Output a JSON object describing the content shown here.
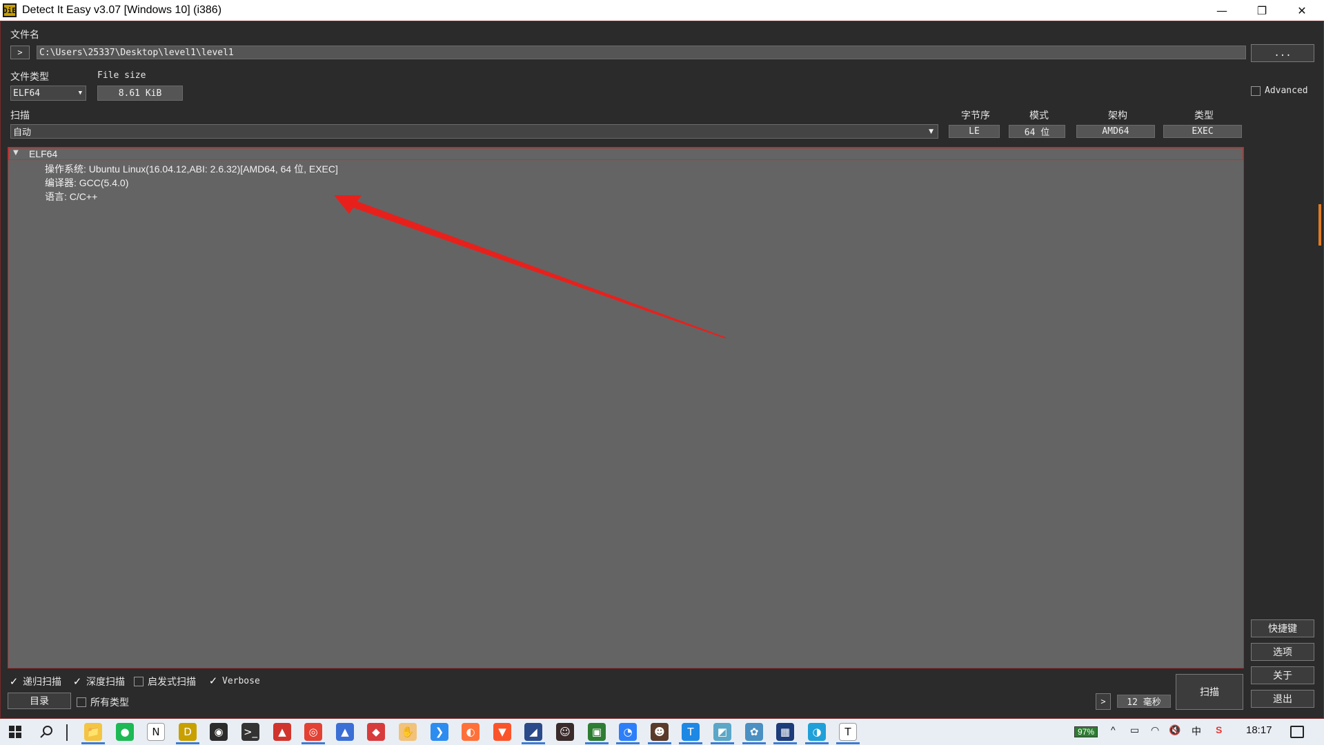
{
  "window": {
    "title": "Detect It Easy v3.07 [Windows 10] (i386)",
    "app_icon_text": "DiE",
    "minimize_glyph": "—",
    "restore_glyph": "❐",
    "close_glyph": "✕"
  },
  "file": {
    "label": "文件名",
    "expand_glyph": ">",
    "path": "C:\\Users\\25337\\Desktop\\level1\\level1",
    "browse_label": "..."
  },
  "filetype": {
    "label": "文件类型",
    "value": "ELF64",
    "size_label": "File size",
    "size_value": "8.61 KiB"
  },
  "advanced": {
    "label": "Advanced",
    "checked": false
  },
  "scan": {
    "label": "扫描",
    "mode": "自动",
    "columns": {
      "endianness": {
        "label": "字节序",
        "value": "LE"
      },
      "mode": {
        "label": "模式",
        "value": "64 位"
      },
      "arch": {
        "label": "架构",
        "value": "AMD64"
      },
      "type": {
        "label": "类型",
        "value": "EXEC"
      }
    }
  },
  "result": {
    "root": "ELF64",
    "expand_glyph": "▼",
    "items": [
      "操作系统: Ubuntu Linux(16.04.12,ABI: 2.6.32)[AMD64, 64 位, EXEC]",
      "编译器: GCC(5.4.0)",
      "语言: C/C++"
    ]
  },
  "annotation": {
    "arrow_color": "#e8201c"
  },
  "options": {
    "recursive": {
      "label": "递归扫描",
      "checked": true
    },
    "deep": {
      "label": "深度扫描",
      "checked": true
    },
    "heuristic": {
      "label": "启发式扫描",
      "checked": false
    },
    "verbose": {
      "label": "Verbose",
      "checked": true
    },
    "all_types": {
      "label": "所有类型",
      "checked": false
    },
    "check_glyph": "✓"
  },
  "bottom": {
    "directory_label": "目录",
    "next_glyph": ">",
    "elapsed": "12 毫秒",
    "scan_button": "扫描"
  },
  "side_buttons": {
    "shortcuts": "快捷键",
    "options": "选项",
    "about": "关于",
    "exit": "退出"
  },
  "taskbar": {
    "battery": "97%",
    "clock": "18:17",
    "tray_glyphs": [
      "^",
      "▭",
      "◠",
      "🔇",
      "中",
      "S"
    ],
    "apps": [
      {
        "name": "file-explorer-icon",
        "glyph": "📁",
        "color": "#f4c542",
        "active": true
      },
      {
        "name": "spotify-icon",
        "glyph": "●",
        "color": "#1db954",
        "active": false
      },
      {
        "name": "notion-icon",
        "glyph": "N",
        "color": "#ffffff",
        "active": false
      },
      {
        "name": "die-icon",
        "glyph": "D",
        "color": "#c8a000",
        "active": true
      },
      {
        "name": "obs-icon",
        "glyph": "◉",
        "color": "#2b2b2b",
        "active": false
      },
      {
        "name": "terminal-icon",
        "glyph": ">_",
        "color": "#333333",
        "active": false
      },
      {
        "name": "red-app-icon",
        "glyph": "▲",
        "color": "#d0342c",
        "active": false
      },
      {
        "name": "chrome-icon",
        "glyph": "◎",
        "color": "#e34133",
        "active": true
      },
      {
        "name": "triangle-app-icon",
        "glyph": "▲",
        "color": "#3b6fd6",
        "active": false
      },
      {
        "name": "diamond-app-icon",
        "glyph": "◆",
        "color": "#d83b3b",
        "active": false
      },
      {
        "name": "gesture-app-icon",
        "glyph": "✋",
        "color": "#f2c27b",
        "active": false
      },
      {
        "name": "vscode-icon",
        "glyph": "❯",
        "color": "#2d8cf0",
        "active": false
      },
      {
        "name": "firefox-icon",
        "glyph": "◐",
        "color": "#ff7139",
        "active": false
      },
      {
        "name": "brave-icon",
        "glyph": "▼",
        "color": "#fb542b",
        "active": false
      },
      {
        "name": "ida-icon",
        "glyph": "◢",
        "color": "#2a4a8a",
        "active": true
      },
      {
        "name": "character-app-icon-1",
        "glyph": "☺",
        "color": "#3a2a2a",
        "active": false
      },
      {
        "name": "green-app-icon",
        "glyph": "▣",
        "color": "#2e7d32",
        "active": true
      },
      {
        "name": "blue-circle-app-icon",
        "glyph": "◔",
        "color": "#2d7ff9",
        "active": true
      },
      {
        "name": "character-app-icon-2",
        "glyph": "☻",
        "color": "#5a3a2a",
        "active": true
      },
      {
        "name": "typora-app-icon",
        "glyph": "T",
        "color": "#1e88e5",
        "active": true
      },
      {
        "name": "notes-app-icon",
        "glyph": "◩",
        "color": "#5aa7c8",
        "active": true
      },
      {
        "name": "network-app-icon",
        "glyph": "✿",
        "color": "#4a90c2",
        "active": true
      },
      {
        "name": "monitor-app-icon",
        "glyph": "▦",
        "color": "#1c3c7a",
        "active": true
      },
      {
        "name": "edge-icon",
        "glyph": "◑",
        "color": "#1fa0d8",
        "active": true
      },
      {
        "name": "text-app-icon",
        "glyph": "T",
        "color": "#ffffff",
        "active": true
      }
    ]
  }
}
